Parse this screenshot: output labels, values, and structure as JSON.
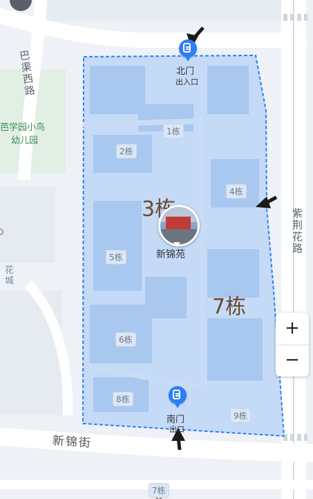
{
  "roads": {
    "bajuxi": "巴渠西路",
    "zijing": "紫荆花路",
    "xinjin": "新锦街",
    "hua_cheng": "花城"
  },
  "places": {
    "kindergarten_line1": "芭学园小鸟",
    "kindergarten_line2": "幼儿园"
  },
  "poi": {
    "name": "新锦苑",
    "photo_icon": "residential-photo-thumbnail"
  },
  "gates": {
    "north": {
      "name": "北门",
      "sub": "出入口",
      "icon": "gate-entrance-icon"
    },
    "south": {
      "name": "南门",
      "sub": "出口",
      "icon": "gate-entrance-icon"
    }
  },
  "buildings": [
    "1栋",
    "2栋",
    "4栋",
    "5栋",
    "6栋",
    "8栋",
    "9栋",
    "7栋"
  ],
  "annotations": {
    "note_3": "3栋",
    "note_7": "7栋"
  },
  "controls": {
    "zoom_in": "+",
    "zoom_out": "−"
  },
  "colors": {
    "area_fill": "#bcd6f7",
    "area_border": "#2d7ef7",
    "pin": "#2d7ef7",
    "road": "#ffffff",
    "annotation": "#6b4a2e"
  }
}
